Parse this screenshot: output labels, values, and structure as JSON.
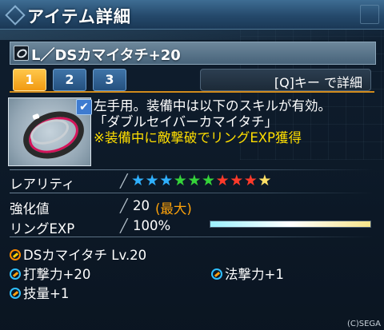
{
  "window": {
    "title": "アイテム詳細"
  },
  "item": {
    "name": "L／DSカマイタチ+20"
  },
  "tabs": [
    {
      "label": "1",
      "active": true
    },
    {
      "label": "2",
      "active": false
    },
    {
      "label": "3",
      "active": false
    }
  ],
  "hint": "[Q]キー で詳細",
  "description": {
    "line1": "左手用。装備中は以下のスキルが有効。",
    "line2": "「ダブルセイバーカマイタチ」",
    "line3": "※装備中に敵撃破でリングEXP獲得"
  },
  "stats": {
    "rarity_label": "レアリティ",
    "rarity_stars": 10,
    "star_colors": [
      "#2fb0ff",
      "#2fb0ff",
      "#2fb0ff",
      "#35d33a",
      "#35d33a",
      "#35d33a",
      "#ff3a2a",
      "#ff3a2a",
      "#ff3a2a",
      "#ffe066"
    ],
    "enhance_label": "強化値",
    "enhance_value": "20",
    "enhance_max": "(最大)",
    "ringexp_label": "リングEXP",
    "ringexp_value": "100%",
    "ringexp_fraction": 1.0
  },
  "skills": {
    "main": "DSカマイタチ  Lv.20",
    "p1": "打撃力+20",
    "p2": "法撃力+1",
    "p3": "技量+1"
  },
  "copyright": "(C)SEGA"
}
